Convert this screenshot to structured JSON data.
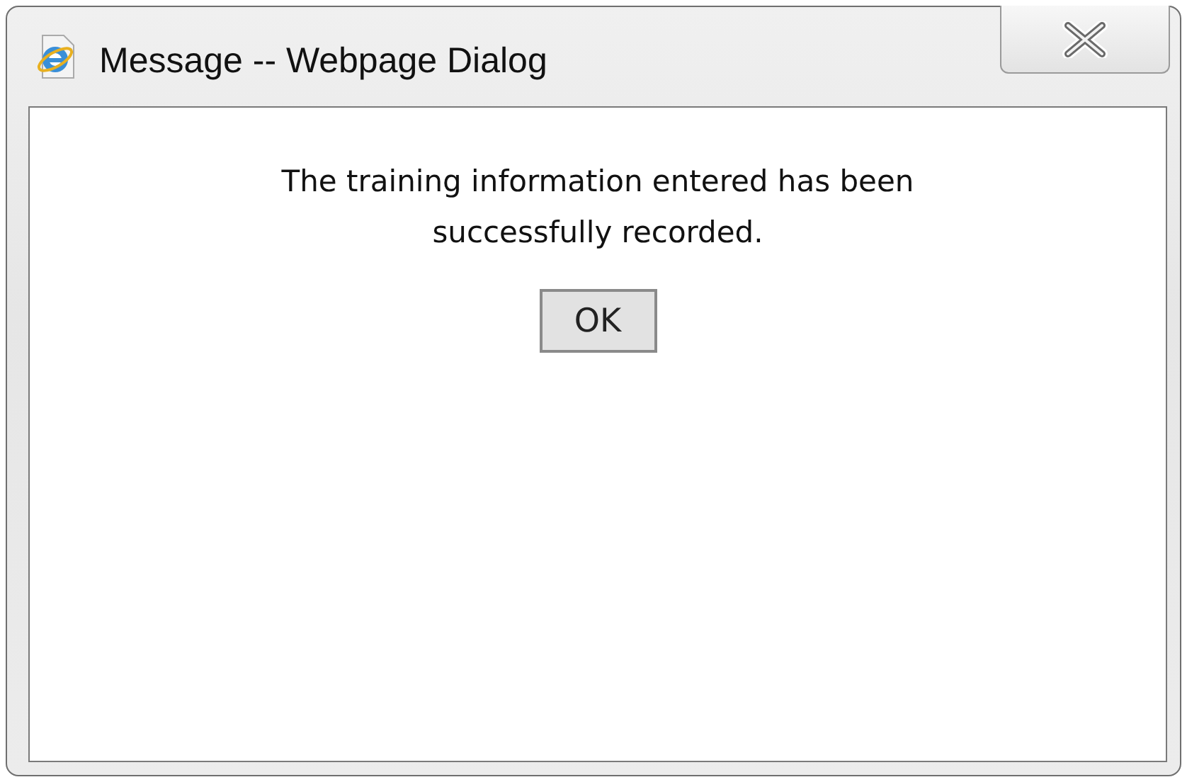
{
  "window": {
    "title": "Message -- Webpage Dialog"
  },
  "message": {
    "lines": [
      "The training information entered has been",
      "successfully recorded."
    ]
  },
  "buttons": [
    "OK"
  ]
}
